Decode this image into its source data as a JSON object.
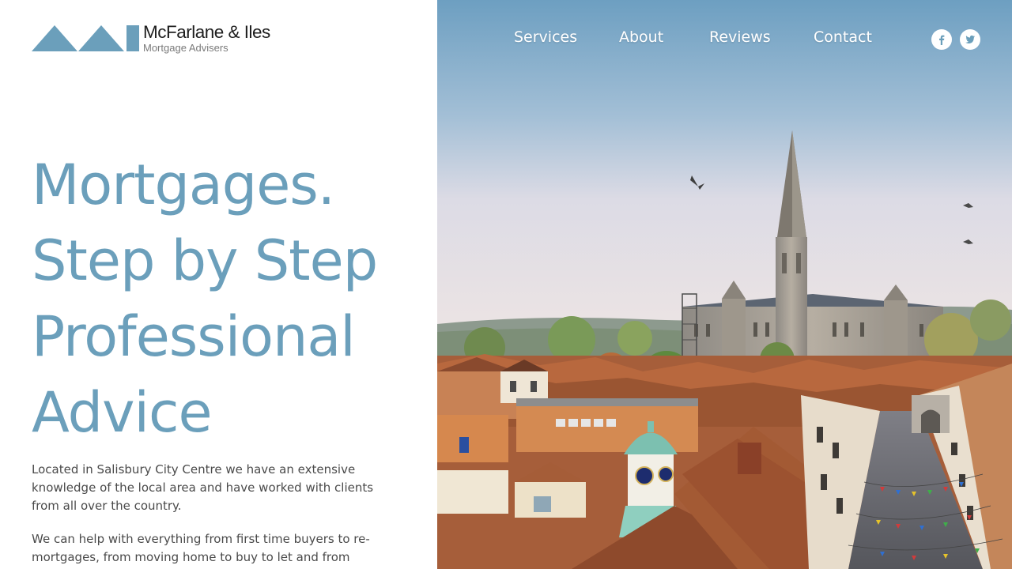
{
  "logo": {
    "name": "McFarlane & Iles",
    "tagline": "Mortgage Advisers",
    "brand_color": "#6b9fbb"
  },
  "nav": {
    "items": [
      {
        "label": "Services"
      },
      {
        "label": "About"
      },
      {
        "label": "Reviews"
      },
      {
        "label": "Contact"
      }
    ],
    "social": [
      {
        "icon": "facebook-icon"
      },
      {
        "icon": "twitter-icon"
      }
    ]
  },
  "hero": {
    "lines": [
      "Mortgages.",
      "Step by Step",
      "Professional",
      "Advice"
    ],
    "color": "#6b9fbb"
  },
  "intro": {
    "p1": "Located in Salisbury City Centre we have an extensive knowledge of the local area and have worked with clients from all over the country.",
    "p2": "We can help with everything from first time buyers to re-mortgages, from moving home to buy to let and from complex"
  },
  "background_image": {
    "subject": "salisbury-cathedral-skyline-photo"
  }
}
